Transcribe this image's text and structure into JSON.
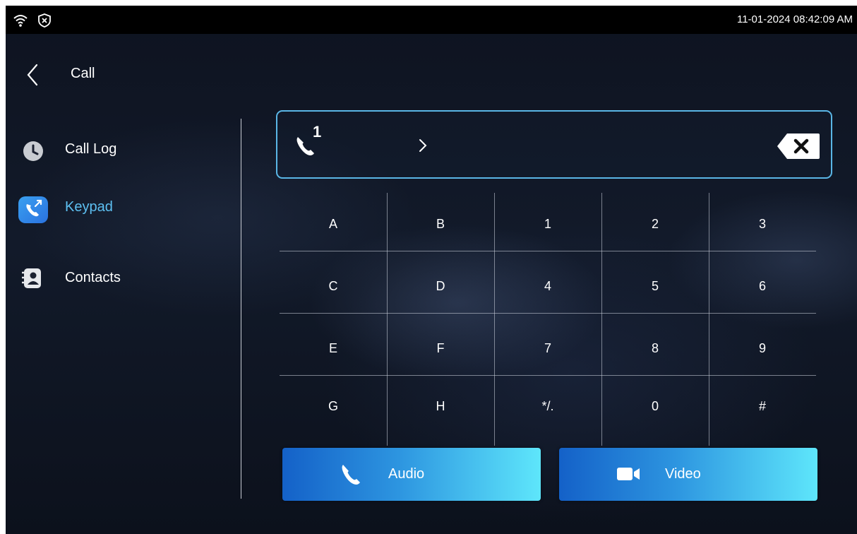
{
  "status_bar": {
    "datetime": "11-01-2024 08:42:09 AM",
    "icons": [
      "wifi-icon",
      "shield-x-icon"
    ]
  },
  "header": {
    "title": "Call",
    "back_icon": "chevron-left-icon"
  },
  "sidebar": {
    "items": [
      {
        "label": "Call Log",
        "icon": "clock-icon",
        "active": false
      },
      {
        "label": "Keypad",
        "icon": "dial-pad-phone-icon",
        "active": true
      },
      {
        "label": "Contacts",
        "icon": "contacts-book-icon",
        "active": false
      }
    ]
  },
  "dial_input": {
    "line_number": "1",
    "value": "",
    "icons": [
      "phone-icon",
      "chevron-right-icon",
      "backspace-icon"
    ]
  },
  "keypad": {
    "rows": [
      [
        "A",
        "B",
        "1",
        "2",
        "3"
      ],
      [
        "C",
        "D",
        "4",
        "5",
        "6"
      ],
      [
        "E",
        "F",
        "7",
        "8",
        "9"
      ],
      [
        "G",
        "H",
        "*/.",
        "0",
        "#"
      ]
    ]
  },
  "actions": {
    "audio_label": "Audio",
    "video_label": "Video"
  },
  "colors": {
    "accent": "#5dc0f2",
    "input_border": "#5ab6e6",
    "button_gradient_start": "#1461c8",
    "button_gradient_end": "#5ee6fb"
  }
}
